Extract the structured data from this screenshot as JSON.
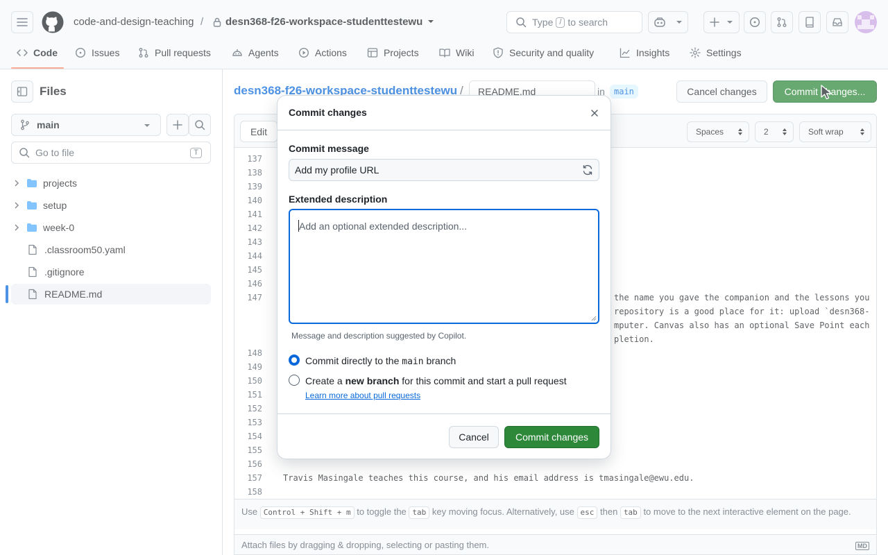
{
  "header": {
    "org": "code-and-design-teaching",
    "separator": "/",
    "repo": "desn368-f26-workspace-studenttestewu",
    "search": {
      "prefix": "Type",
      "key": "/",
      "suffix": "to search"
    }
  },
  "nav": {
    "tabs": [
      {
        "label": "Code"
      },
      {
        "label": "Issues"
      },
      {
        "label": "Pull requests"
      },
      {
        "label": "Agents"
      },
      {
        "label": "Actions"
      },
      {
        "label": "Projects"
      },
      {
        "label": "Wiki"
      },
      {
        "label": "Security and quality"
      },
      {
        "label": "Insights"
      },
      {
        "label": "Settings"
      }
    ],
    "selected": "Code"
  },
  "sidebar": {
    "title": "Files",
    "branch": "main",
    "filter_placeholder": "Go to file",
    "filter_key": "T",
    "tree": [
      {
        "label": "projects",
        "type": "folder"
      },
      {
        "label": "setup",
        "type": "folder"
      },
      {
        "label": "week-0",
        "type": "folder"
      },
      {
        "label": ".classroom50.yaml",
        "type": "file"
      },
      {
        "label": ".gitignore",
        "type": "file"
      },
      {
        "label": "README.md",
        "type": "file",
        "selected": true
      }
    ]
  },
  "editor": {
    "repo_link": "desn368-f26-workspace-studenttestewu",
    "path_sep": "/",
    "filename": "README.md",
    "in_label": "in",
    "branch": "main",
    "cancel_label": "Cancel changes",
    "commit_label": "Commit changes...",
    "edit_tab": "Edit",
    "indent_mode": "Spaces",
    "indent_size": "2",
    "wrap_mode": "Soft wrap",
    "line_numbers": [
      "137",
      "138",
      "139",
      "140",
      "141",
      "142",
      "143",
      "144",
      "145",
      "146",
      "147",
      "148",
      "149",
      "150",
      "151",
      "152",
      "153",
      "154",
      "155",
      "156",
      "157",
      "158"
    ],
    "visible_code": {
      "l147a": "the name you gave the companion and the lessons you",
      "l147b": "repository is a good place for it: upload `desn368-",
      "l147c": "mputer. Canvas also has an optional Save Point each",
      "l147d": "pletion.",
      "l157": "Travis Masingale teaches this course, and his email address is tmasingale@ewu.edu."
    },
    "hint": {
      "use": "Use",
      "keys": "Control + Shift + m",
      "to_toggle": "to toggle the",
      "tab": "tab",
      "moving": "key moving focus. Alternatively, use",
      "esc": "esc",
      "then": "then",
      "tab2": "tab",
      "to_move": "to move to the next interactive element on the page."
    },
    "attach": "Attach files by dragging & dropping, selecting or pasting them.",
    "md_badge": "MD"
  },
  "dialog": {
    "title": "Commit changes",
    "message_label": "Commit message",
    "message_value": "Add my profile URL",
    "desc_label": "Extended description",
    "desc_placeholder": "Add an optional extended description...",
    "copilot_note": "Message and description suggested by Copilot.",
    "option1": {
      "pre": "Commit directly to the",
      "branch": "main",
      "post": "branch",
      "selected": true
    },
    "option2": {
      "pre": "Create a",
      "bold": "new branch",
      "post": "for this commit and start a pull request",
      "selected": false
    },
    "learn_more": "Learn more about pull requests",
    "cancel": "Cancel",
    "commit": "Commit changes"
  },
  "colors": {
    "accent": "#0969da",
    "primary_button": "#2d883a",
    "nav_underline": "#fd8c73"
  }
}
